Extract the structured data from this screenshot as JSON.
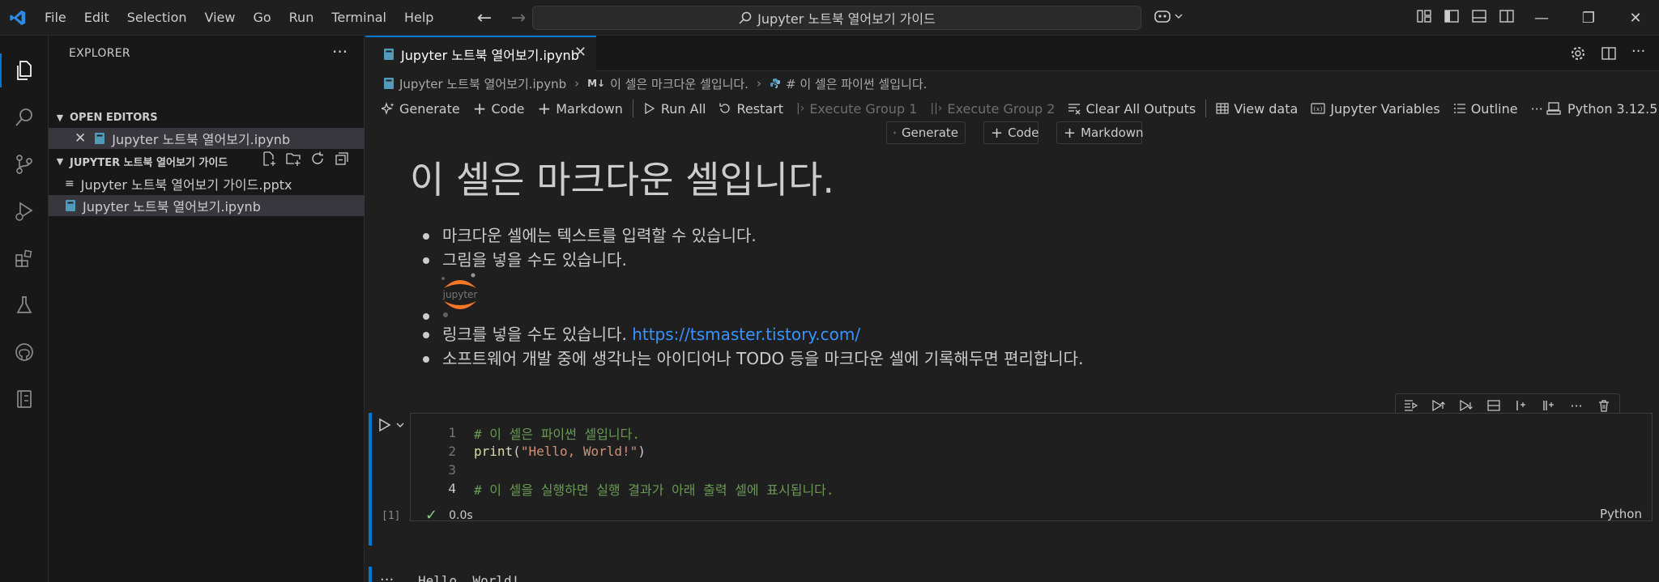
{
  "menu": [
    "File",
    "Edit",
    "Selection",
    "View",
    "Go",
    "Run",
    "Terminal",
    "Help"
  ],
  "search": {
    "text": "Jupyter 노트북 열어보기 가이드"
  },
  "sidebar": {
    "title": "EXPLORER",
    "open_editors_label": "OPEN EDITORS",
    "open_editors": [
      {
        "name": "Jupyter 노트북 열어보기.ipynb"
      }
    ],
    "folder_label": "JUPYTER 노트북 열어보기 가이드",
    "files": [
      {
        "name": "Jupyter 노트북 열어보기 가이드.pptx"
      },
      {
        "name": "Jupyter 노트북 열어보기.ipynb"
      }
    ]
  },
  "tab": {
    "label": "Jupyter 노트북 열어보기.ipynb"
  },
  "breadcrumb": {
    "file": "Jupyter 노트북 열어보기.ipynb",
    "md_badge": "M↓",
    "md_cell": "이 셀은 마크다운 셀입니다.",
    "code_cell": "# 이 셀은 파이썬 셀입니다."
  },
  "toolbar": {
    "generate": "Generate",
    "code": "Code",
    "markdown": "Markdown",
    "run_all": "Run All",
    "restart": "Restart",
    "exec_group1": "Execute Group 1",
    "exec_group2": "Execute Group 2",
    "clear_outputs": "Clear All Outputs",
    "view_data": "View data",
    "variables": "Jupyter Variables",
    "outline": "Outline",
    "more": "···",
    "kernel": "Python 3.12.5"
  },
  "insert": {
    "generate": "Generate",
    "code": "Code",
    "markdown": "Markdown"
  },
  "markdown_cell": {
    "heading": "이 셀은 마크다운 셀입니다.",
    "item1": "마크다운 셀에는 텍스트를 입력할 수 있습니다.",
    "item2": "그림을 넣을 수도 있습니다.",
    "logo_text": "jupyter",
    "item4_text": "링크를 넣을 수도 있습니다. ",
    "item4_link": "https://tsmaster.tistory.com/",
    "item5": "소프트웨어 개발 중에 생각나는 아이디어나 TODO 등을 마크다운 셀에 기록해두면 편리합니다."
  },
  "code_cell": {
    "lines": [
      {
        "n": "1",
        "comment": "# 이 셀은 파이썬 셀입니다."
      },
      {
        "n": "2",
        "fn": "print",
        "open": "(",
        "str": "\"Hello, World!\"",
        "close": ")"
      },
      {
        "n": "3"
      },
      {
        "n": "4",
        "comment": "# 이 셀을 실행하면 실행 결과가 아래 출력 셀에 표시됩니다."
      }
    ],
    "exec_count": "[1]",
    "duration": "0.0s",
    "language": "Python",
    "output": "Hello, World!",
    "output_more": "···"
  },
  "colors": {
    "accent": "#0078d4",
    "link": "#3794ff",
    "comment": "#6a9955",
    "string": "#ce9178",
    "function": "#dcdcaa"
  }
}
